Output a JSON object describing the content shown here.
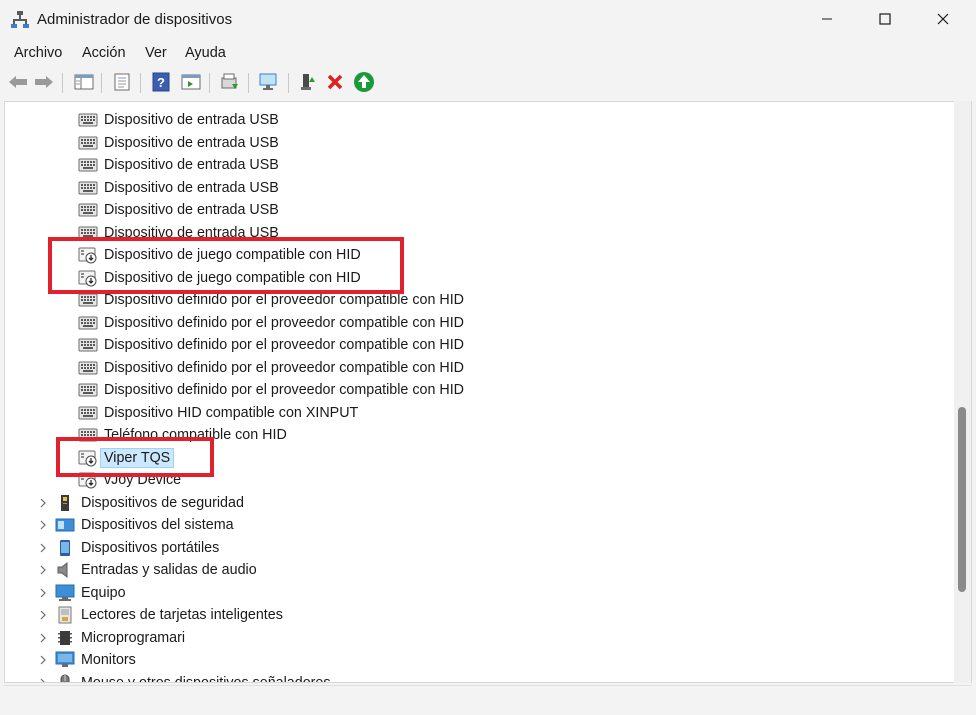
{
  "window": {
    "title": "Administrador de dispositivos",
    "icon": "device-manager-icon"
  },
  "menu": {
    "archivo": "Archivo",
    "accion": "Acción",
    "ver": "Ver",
    "ayuda": "Ayuda"
  },
  "toolbar": {
    "icons": [
      "back-arrow-icon",
      "forward-arrow-icon",
      "show-hide-console-tree-icon",
      "properties-icon",
      "help-icon",
      "action-pane-icon",
      "update-driver-icon",
      "scan-hardware-icon",
      "enable-device-icon",
      "uninstall-device-icon",
      "update-icon"
    ]
  },
  "tree": {
    "hid_children": [
      "Dispositivo de entrada USB",
      "Dispositivo de entrada USB",
      "Dispositivo de entrada USB",
      "Dispositivo de entrada USB",
      "Dispositivo de entrada USB",
      "Dispositivo de entrada USB",
      "Dispositivo de juego  compatible con HID",
      "Dispositivo de juego  compatible con HID",
      "Dispositivo definido por el proveedor compatible con HID",
      "Dispositivo definido por el proveedor compatible con HID",
      "Dispositivo definido por el proveedor compatible con HID",
      "Dispositivo definido por el proveedor compatible con HID",
      "Dispositivo definido por el proveedor compatible con HID",
      "Dispositivo HID compatible con XINPUT",
      "Teléfono compatible con HID",
      "Viper TQS",
      "vJoy Device"
    ],
    "selected": "Viper TQS",
    "categories": [
      "Dispositivos de seguridad",
      "Dispositivos del sistema",
      "Dispositivos portátiles",
      "Entradas y salidas de audio",
      "Equipo",
      "Lectores de tarjetas inteligentes",
      "Microprogramari",
      "Monitors",
      "Mouse y otros dispositivos señaladores"
    ]
  },
  "colors": {
    "highlight": "#e0212e",
    "selection": "#cce8ff",
    "selection_border": "#99d1ff"
  }
}
